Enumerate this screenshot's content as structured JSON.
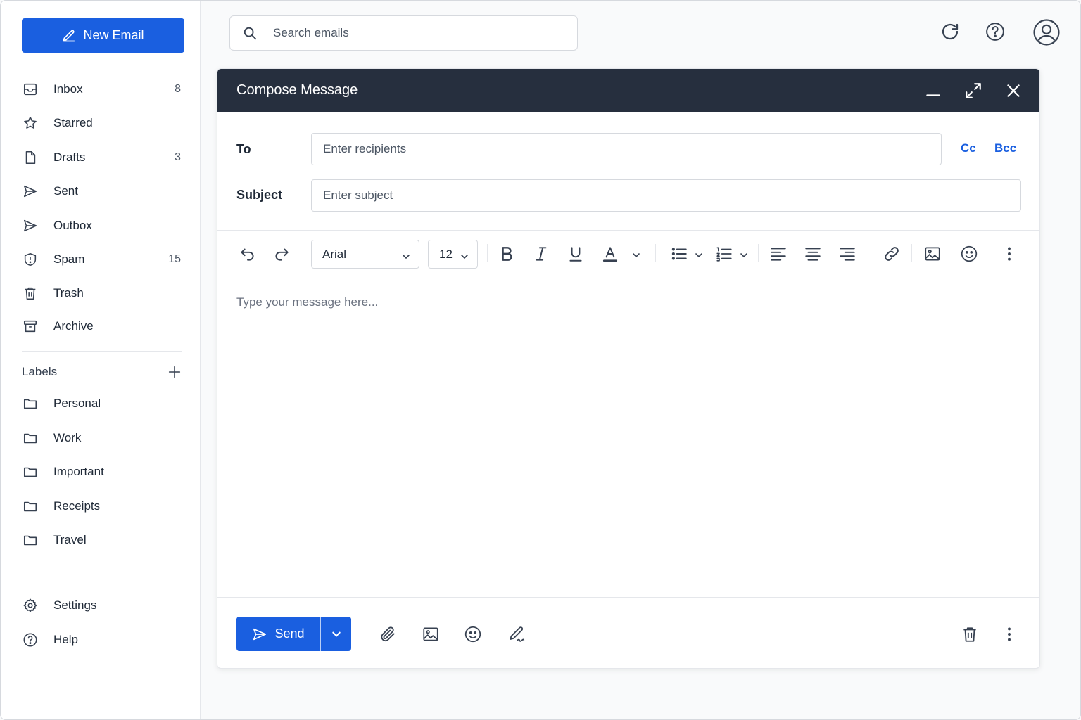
{
  "sidebar": {
    "new_email_label": "New Email",
    "items": [
      {
        "label": "Inbox",
        "count": "8",
        "icon": "inbox-icon"
      },
      {
        "label": "Starred",
        "count": "",
        "icon": "star-icon"
      },
      {
        "label": "Drafts",
        "count": "3",
        "icon": "file-icon"
      },
      {
        "label": "Sent",
        "count": "",
        "icon": "send-icon"
      },
      {
        "label": "Outbox",
        "count": "",
        "icon": "send-icon"
      },
      {
        "label": "Spam",
        "count": "15",
        "icon": "shield-icon"
      },
      {
        "label": "Trash",
        "count": "",
        "icon": "trash-icon"
      },
      {
        "label": "Archive",
        "count": "",
        "icon": "archive-icon"
      }
    ],
    "labels_title": "Labels",
    "labels": [
      {
        "label": "Personal",
        "icon": "folder-icon"
      },
      {
        "label": "Work",
        "icon": "folder-icon"
      },
      {
        "label": "Important",
        "icon": "folder-icon"
      },
      {
        "label": "Receipts",
        "icon": "folder-icon"
      },
      {
        "label": "Travel",
        "icon": "folder-icon"
      }
    ],
    "bottom": [
      {
        "label": "Settings",
        "icon": "gear-icon"
      },
      {
        "label": "Help",
        "icon": "help-icon"
      }
    ]
  },
  "topbar": {
    "search_placeholder": "Search emails",
    "icons": [
      "refresh-icon",
      "help-icon",
      "user-icon"
    ]
  },
  "compose": {
    "title": "Compose Message",
    "to_label": "To",
    "to_placeholder": "Enter recipients",
    "cc_label": "Cc",
    "bcc_label": "Bcc",
    "subject_label": "Subject",
    "subject_placeholder": "Enter subject",
    "font_family": "Arial",
    "font_size": "12",
    "message_placeholder": "Type your message here...",
    "send_label": "Send"
  },
  "colors": {
    "primary": "#1a5fe0",
    "header": "#262f3e"
  }
}
